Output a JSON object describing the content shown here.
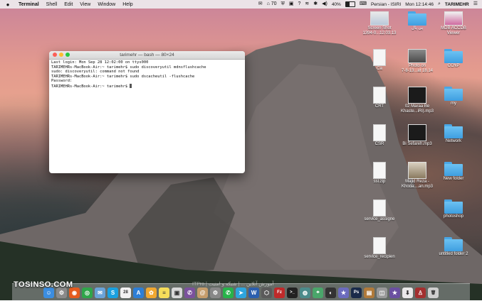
{
  "menubar": {
    "app_name": "Terminal",
    "items": [
      "Shell",
      "Edit",
      "View",
      "Window",
      "Help"
    ],
    "mail_count": "70",
    "battery_percent": "40%",
    "battery_level": 0.4,
    "input_source": "Persian - ISIRI",
    "clock": "Mon 12:14:46",
    "user": "TARIMEHR"
  },
  "terminal": {
    "title": "tarimehr — bash — 80×24",
    "lines": [
      "Last login: Mon Sep 28 12:02:00 on ttys000",
      "TARIMEHRs-MacBook-Air:~ tarimehr$ sudo discoveryutil mdnsflushcache",
      "sudo: discoveryutil: command not found",
      "TARIMEHRs-MacBook-Air:~ tarimehr$ sudo dscacheutil -flushcache",
      "Password:",
      "TARIMEHRs-MacBook-Air:~ tarimehr$ "
    ]
  },
  "desktop": {
    "col1": [
      {
        "label": "Screen Shot\n1394-0...12.03.13",
        "kind": "screenshot"
      },
      {
        "label": "Ca",
        "kind": "doc"
      },
      {
        "label": "CRT",
        "kind": "doc"
      },
      {
        "label": "CSR",
        "kind": "doc"
      },
      {
        "label": "ssl.zip",
        "kind": "zip"
      },
      {
        "label": "service_assigne",
        "kind": "doc"
      },
      {
        "label": "service_recipien",
        "kind": "doc"
      }
    ],
    "col2": [
      {
        "label": "پی پال",
        "kind": "folder"
      },
      {
        "label": "Photo on\n7-8-13...at 18.14",
        "kind": "photo"
      },
      {
        "label": "02 Maraa Be\nKhaste...iRi).mp3",
        "kind": "mp3"
      },
      {
        "label": "Bi Sefareh.mp3",
        "kind": "mp3"
      },
      {
        "label": "Majid Reza -\nKhoda....an.mp3",
        "kind": "mp3b"
      }
    ],
    "col3": [
      {
        "label": "MDB ACCDB\nViewer",
        "kind": "app"
      },
      {
        "label": "CCNP",
        "kind": "folder"
      },
      {
        "label": "my",
        "kind": "folder"
      },
      {
        "label": "Network",
        "kind": "folder"
      },
      {
        "label": "New folder",
        "kind": "folder"
      },
      {
        "label": "photoshop",
        "kind": "folder"
      },
      {
        "label": "untitled folder 2",
        "kind": "folder"
      }
    ]
  },
  "watermark": "TOSINSO.COM",
  "dock_caption": "ITPro | آموزش آنلاین ... | شبکه و امنیت",
  "dock": [
    {
      "name": "finder-icon",
      "color": "#3b8de0",
      "glyph": "☺"
    },
    {
      "name": "launchpad-icon",
      "color": "#8a8a8a",
      "glyph": "⚙"
    },
    {
      "name": "firefox-icon",
      "color": "#e55b1e",
      "glyph": "◉"
    },
    {
      "name": "chrome-icon",
      "color": "#2fa64a",
      "glyph": "◎"
    },
    {
      "name": "mail-icon",
      "color": "#6aa3d8",
      "glyph": "✉"
    },
    {
      "name": "skype-icon",
      "color": "#1aa1e0",
      "glyph": "S"
    },
    {
      "name": "calendar-icon",
      "color": "#f2f2f2",
      "glyph": "28"
    },
    {
      "name": "appstore-icon",
      "color": "#2d7fd6",
      "glyph": "A"
    },
    {
      "name": "photos-icon",
      "color": "#f0a830",
      "glyph": "✿"
    },
    {
      "name": "notes-icon",
      "color": "#f5dd5a",
      "glyph": "≡"
    },
    {
      "name": "preview-icon",
      "color": "#d8d8d8",
      "glyph": "▣"
    },
    {
      "name": "viber-icon",
      "color": "#7b519d",
      "glyph": "✆"
    },
    {
      "name": "contacts-icon",
      "color": "#c59d6b",
      "glyph": "@"
    },
    {
      "name": "settings-icon",
      "color": "#888888",
      "glyph": "⚙"
    },
    {
      "name": "whatsapp-icon",
      "color": "#27b34a",
      "glyph": "✆"
    },
    {
      "name": "telegram-icon",
      "color": "#2ea5dd",
      "glyph": "➤"
    },
    {
      "name": "word-icon",
      "color": "#2b5fae",
      "glyph": "W"
    },
    {
      "name": "network-icon",
      "color": "#5a5a5a",
      "glyph": "⬡"
    },
    {
      "name": "filezilla-icon",
      "color": "#bf2a2a",
      "glyph": "Fz"
    },
    {
      "name": "terminal-icon",
      "color": "#222222",
      "glyph": ">_"
    },
    {
      "name": "eye-icon",
      "color": "#4b8b8b",
      "glyph": "◍"
    },
    {
      "name": "maps-icon",
      "color": "#4aa56a",
      "glyph": "⌖"
    },
    {
      "name": "github-icon",
      "color": "#333333",
      "glyph": "◐"
    },
    {
      "name": "star-icon",
      "color": "#6b6bbd",
      "glyph": "★"
    },
    {
      "name": "photoshop-icon",
      "color": "#1a2b4a",
      "glyph": "Ps"
    },
    {
      "name": "archive-icon",
      "color": "#b07a3a",
      "glyph": "▤"
    },
    {
      "name": "image-icon",
      "color": "#999999",
      "glyph": "◫"
    },
    {
      "name": "imovie-icon",
      "color": "#6a4fa0",
      "glyph": "★"
    },
    {
      "name": "downloads-icon",
      "color": "#e9e9e9",
      "glyph": "⬇"
    },
    {
      "name": "wine-icon",
      "color": "#a33030",
      "glyph": "♙"
    },
    {
      "name": "trash-icon",
      "color": "#cfcfcf",
      "glyph": "🗑"
    }
  ]
}
